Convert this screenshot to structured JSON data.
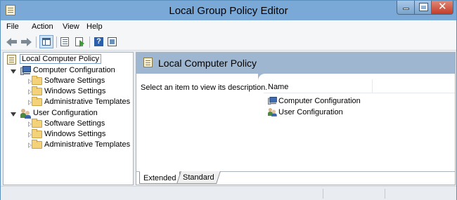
{
  "window": {
    "title": "Local Group Policy Editor"
  },
  "menu": {
    "items": [
      "File",
      "Action",
      "View",
      "Help"
    ]
  },
  "tree": {
    "root": "Local Computer Policy",
    "computer_config": {
      "label": "Computer Configuration",
      "children": [
        "Software Settings",
        "Windows Settings",
        "Administrative Templates"
      ]
    },
    "user_config": {
      "label": "User Configuration",
      "children": [
        "Software Settings",
        "Windows Settings",
        "Administrative Templates"
      ]
    }
  },
  "content": {
    "title": "Local Computer Policy",
    "description": "Select an item to view its description.",
    "column_name": "Name",
    "items": [
      "Computer Configuration",
      "User Configuration"
    ]
  },
  "tabs": [
    "Extended",
    "Standard"
  ],
  "colors": {
    "titlebar": "#7aa9d8",
    "pane_header": "#9fb6d0",
    "close_button": "#c43b28"
  }
}
